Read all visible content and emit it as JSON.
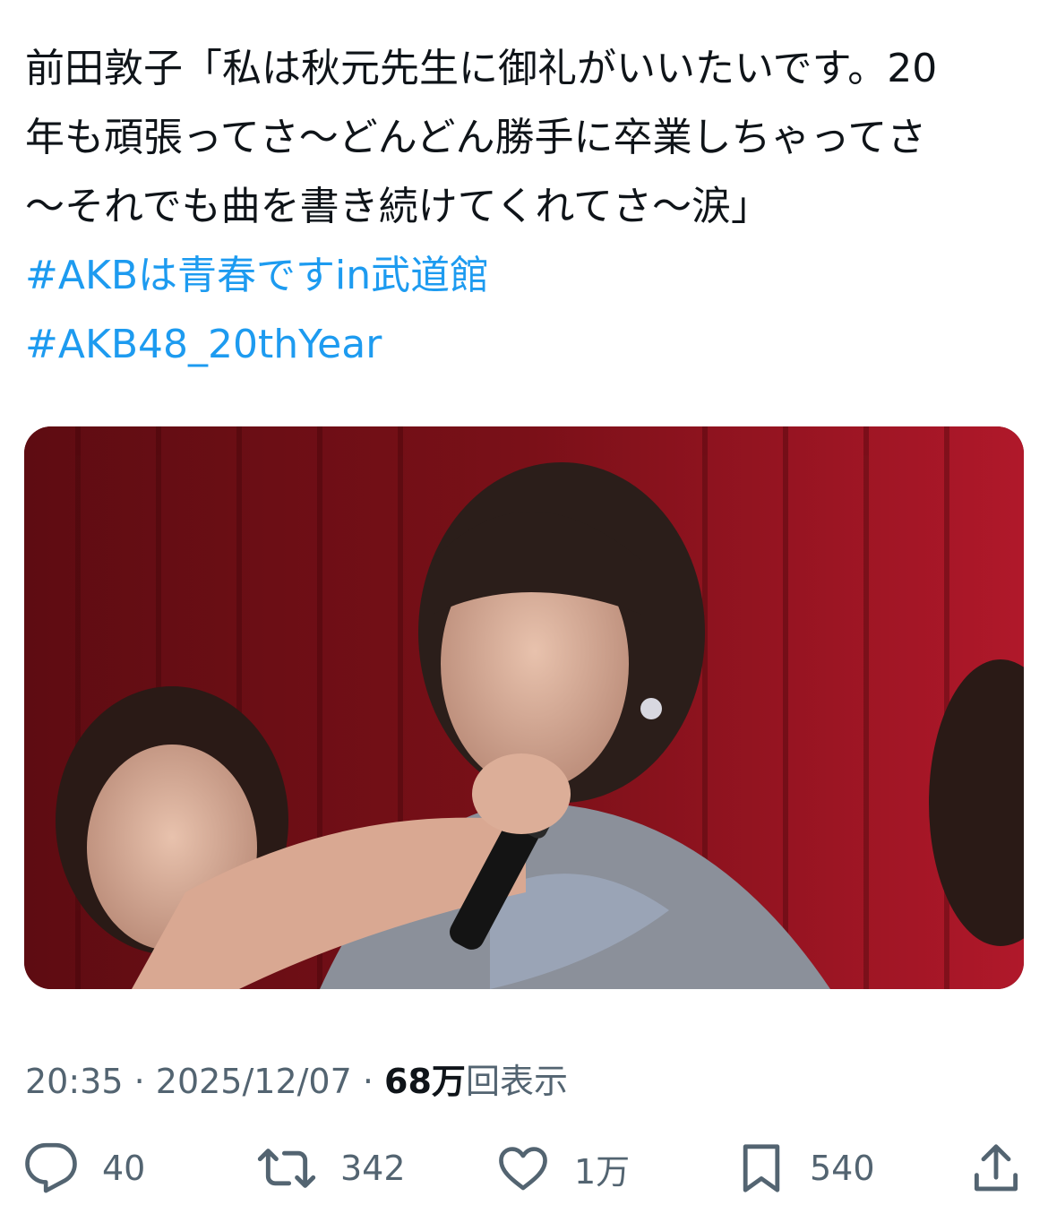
{
  "tweet": {
    "text_lines": [
      "前田敦子「私は秋元先生に御礼がいいたいです。20",
      "年も頑張ってさ〜どんどん勝手に卒業しちゃってさ",
      "〜それでも曲を書き続けてくれてさ〜涙」"
    ],
    "hashtags": [
      "#AKBは青春ですin武道館",
      "#AKB48_20thYear"
    ],
    "hashtag_color": "#1d9bf0"
  },
  "meta": {
    "time": "20:35",
    "separator": " · ",
    "date": "2025/12/07",
    "views_count": "68万",
    "views_label": "回表示"
  },
  "actions": [
    {
      "icon": "reply-icon",
      "count": "40"
    },
    {
      "icon": "retweet-icon",
      "count": "342"
    },
    {
      "icon": "heart-icon",
      "count": "1万"
    },
    {
      "icon": "bookmark-icon",
      "count": "540"
    },
    {
      "icon": "share-icon",
      "count": ""
    }
  ],
  "colors": {
    "text": "#0f1419",
    "secondary": "#536471",
    "link": "#1d9bf0"
  }
}
